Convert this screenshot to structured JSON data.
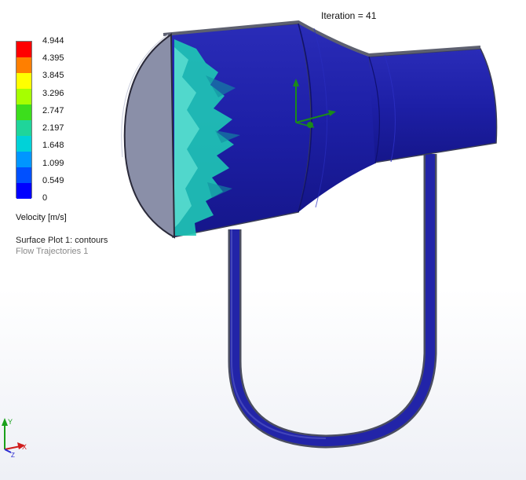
{
  "header": {
    "iteration_text": "Iteration = 41"
  },
  "legend": {
    "ticks": [
      "4.944",
      "4.395",
      "3.845",
      "3.296",
      "2.747",
      "2.197",
      "1.648",
      "1.099",
      "0.549",
      "0"
    ],
    "colors": [
      "#ff0000",
      "#ff7f00",
      "#ffff00",
      "#a6ff00",
      "#3cde1c",
      "#1fd59a",
      "#00d2d8",
      "#0096ff",
      "#0050ff",
      "#0000ff"
    ],
    "units": "Velocity [m/s]"
  },
  "plots": {
    "surface_plot": "Surface Plot 1: contours",
    "flow_trajectories": "Flow Trajectories 1"
  },
  "triad": {
    "x_label": "X",
    "y_label": "Y",
    "z_label": "Z"
  },
  "scene": {
    "body_color": "#1d1fa0",
    "cyan_contour_color": "#1fc8b5",
    "inlet_face_color": "#8a8fa8"
  }
}
